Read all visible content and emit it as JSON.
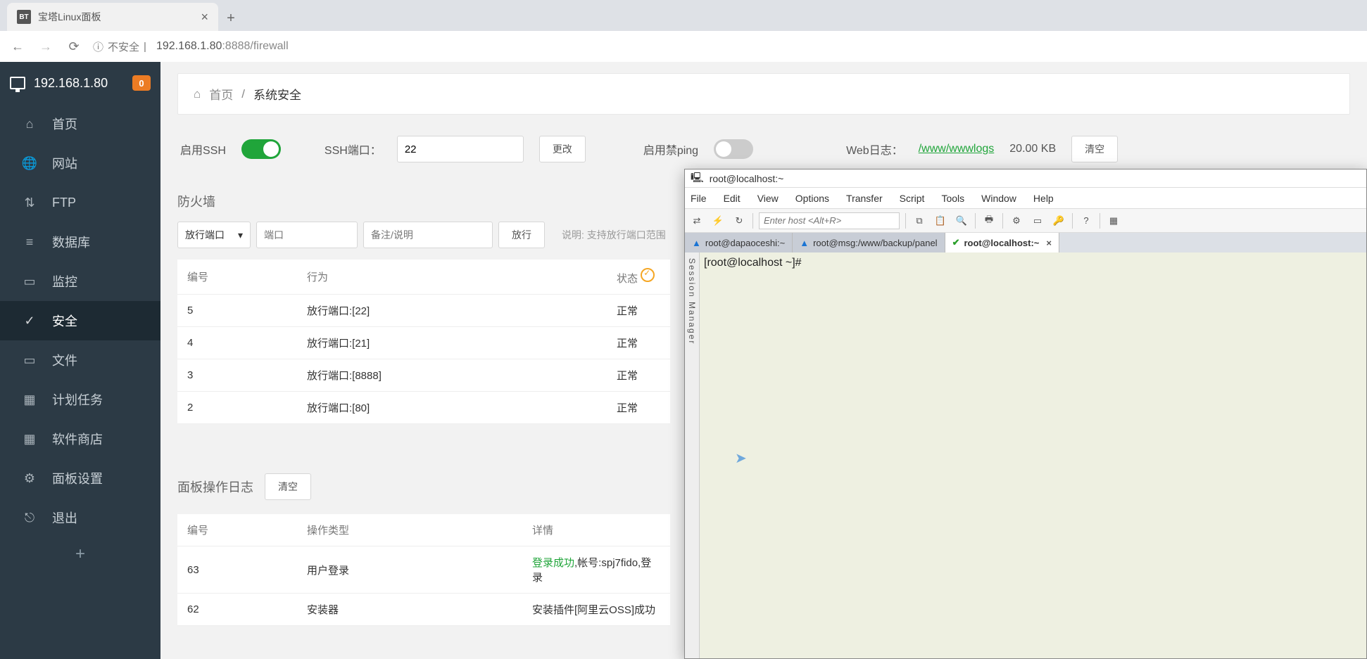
{
  "browser": {
    "tab_title": "宝塔Linux面板",
    "tab_favicon": "BT",
    "url_insecure_label": "不安全",
    "url_host": "192.168.1.80",
    "url_port": ":8888",
    "url_path": "/firewall"
  },
  "sidebar": {
    "host": "192.168.1.80",
    "msg_count": "0",
    "items": [
      {
        "label": "首页",
        "icon": "home"
      },
      {
        "label": "网站",
        "icon": "globe"
      },
      {
        "label": "FTP",
        "icon": "ftp"
      },
      {
        "label": "数据库",
        "icon": "database"
      },
      {
        "label": "监控",
        "icon": "monitor"
      },
      {
        "label": "安全",
        "icon": "shield"
      },
      {
        "label": "文件",
        "icon": "folder"
      },
      {
        "label": "计划任务",
        "icon": "calendar"
      },
      {
        "label": "软件商店",
        "icon": "apps"
      },
      {
        "label": "面板设置",
        "icon": "gear"
      },
      {
        "label": "退出",
        "icon": "logout"
      }
    ]
  },
  "breadcrumb": {
    "home": "首页",
    "sep": "/",
    "current": "系统安全"
  },
  "settings": {
    "ssh_enable_label": "启用SSH",
    "ssh_port_label": "SSH端口：",
    "ssh_port_value": "22",
    "change_btn": "更改",
    "disable_ping_label": "启用禁ping",
    "weblog_label": "Web日志：",
    "weblog_path": "/www/wwwlogs",
    "weblog_size": "20.00 KB",
    "clear_btn": "清空"
  },
  "firewall": {
    "title": "防火墙",
    "release_port_sel": "放行端口",
    "port_placeholder": "端口",
    "note_placeholder": "备注/说明",
    "release_btn": "放行",
    "hint": "说明: 支持放行端口范围",
    "headers": {
      "id": "编号",
      "action": "行为",
      "status": "状态"
    },
    "rows": [
      {
        "id": "5",
        "action": "放行端口:[22]",
        "status": "正常"
      },
      {
        "id": "4",
        "action": "放行端口:[21]",
        "status": "正常"
      },
      {
        "id": "3",
        "action": "放行端口:[8888]",
        "status": "正常"
      },
      {
        "id": "2",
        "action": "放行端口:[80]",
        "status": "正常"
      }
    ]
  },
  "oplog": {
    "title": "面板操作日志",
    "clear_btn": "清空",
    "headers": {
      "id": "编号",
      "type": "操作类型",
      "detail": "详情"
    },
    "rows": [
      {
        "id": "63",
        "type": "用户登录",
        "succ": "登录成功",
        "detail": ",帐号:spj7fido,登录"
      },
      {
        "id": "62",
        "type": "安装器",
        "succ": "",
        "detail": "安装插件[阿里云OSS]成功"
      }
    ]
  },
  "terminal": {
    "title": "root@localhost:~",
    "menu": [
      "File",
      "Edit",
      "View",
      "Options",
      "Transfer",
      "Script",
      "Tools",
      "Window",
      "Help"
    ],
    "host_placeholder": "Enter host <Alt+R>",
    "tabs": [
      {
        "label": "root@dapaoceshi:~",
        "icon": "warn"
      },
      {
        "label": "root@msg:/www/backup/panel",
        "icon": "warn"
      },
      {
        "label": "root@localhost:~",
        "icon": "ok",
        "active": true
      }
    ],
    "session_manager": "Session Manager",
    "prompt": "[root@localhost ~]#"
  }
}
